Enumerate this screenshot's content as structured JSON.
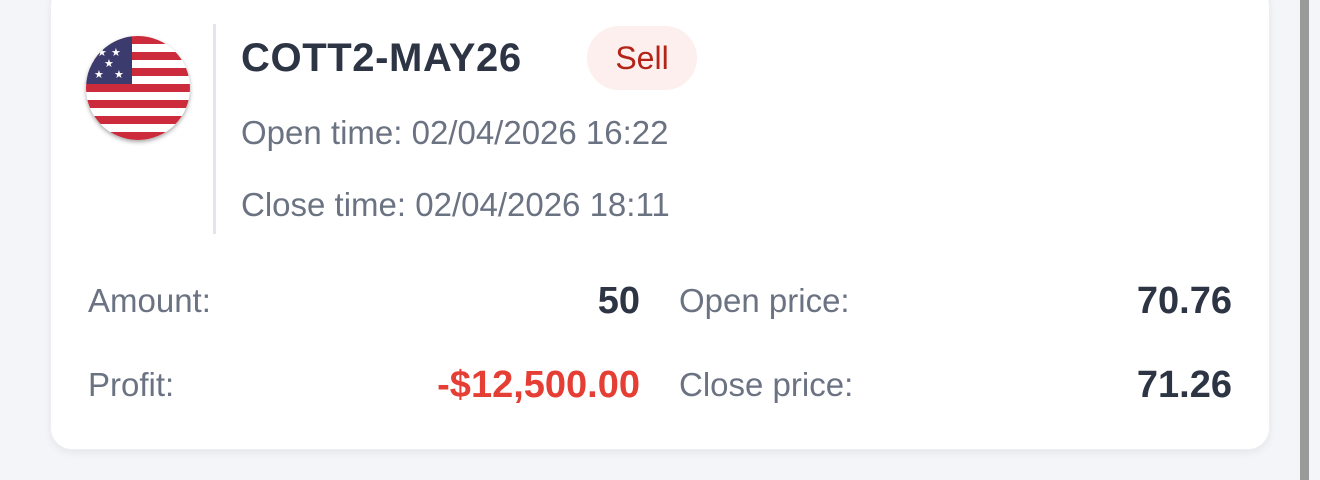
{
  "trade": {
    "symbol": "COTT2-MAY26",
    "side": "Sell",
    "flag_icon": "us-flag-icon",
    "open_time_label": "Open time:",
    "open_time": "02/04/2026 16:22",
    "close_time_label": "Close time:",
    "close_time": "02/04/2026 18:11"
  },
  "stats": {
    "amount_label": "Amount:",
    "amount": "50",
    "profit_label": "Profit:",
    "profit": "-$12,500.00",
    "open_price_label": "Open price:",
    "open_price": "70.76",
    "close_price_label": "Close price:",
    "close_price": "71.26"
  },
  "colors": {
    "sell_badge_bg": "#fcefee",
    "sell_badge_text": "#b42318",
    "loss": "#e53e34",
    "text_primary": "#2d3444",
    "text_secondary": "#6b7383"
  }
}
